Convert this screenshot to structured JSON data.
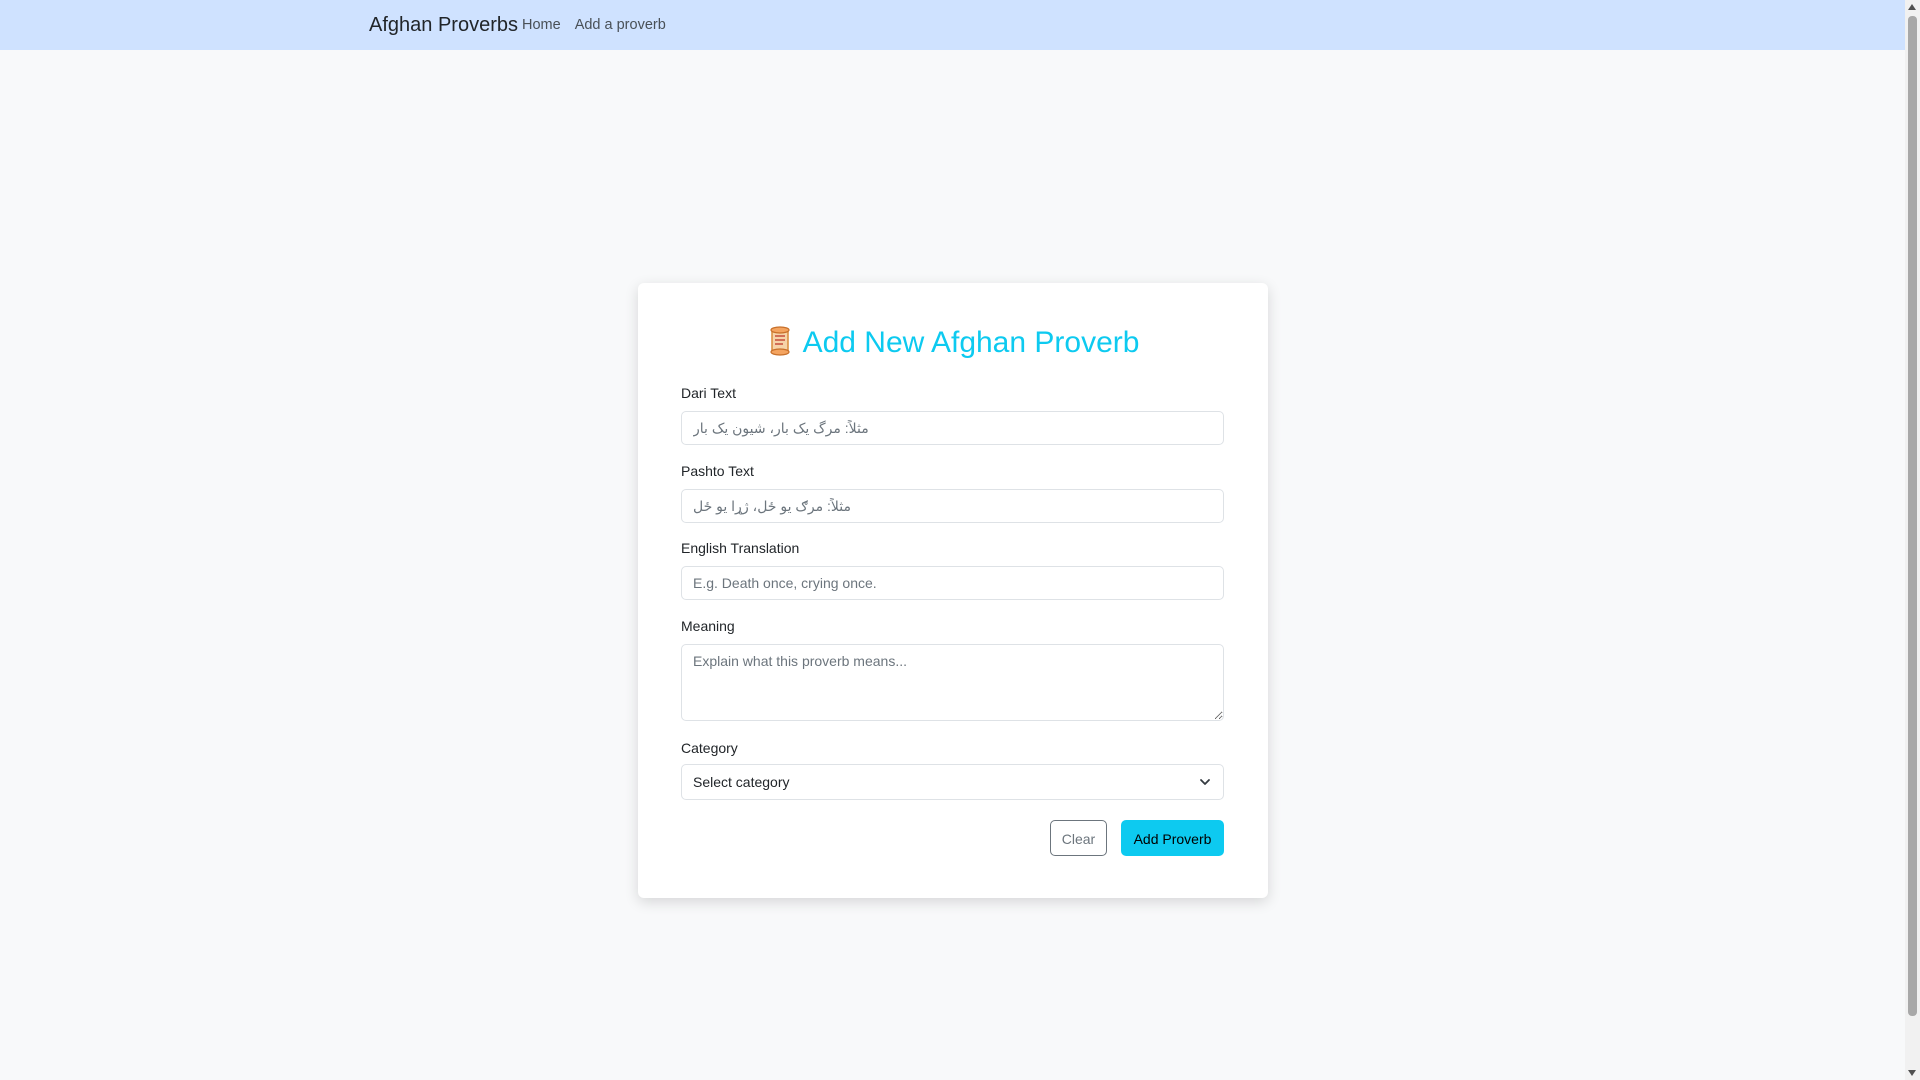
{
  "navbar": {
    "brand": "Afghan Proverbs",
    "links": [
      "Home",
      "Add a proverb"
    ]
  },
  "form": {
    "title": "Add New Afghan Proverb",
    "title_icon": "scroll-icon",
    "accent_color": "#0dcaf0",
    "fields": {
      "dari": {
        "label": "Dari Text",
        "placeholder": "مثلاً: مرگ یک بار، شیون یک بار",
        "value": ""
      },
      "pashto": {
        "label": "Pashto Text",
        "placeholder": "مثلاً: مرګ یو ځل، ژړا یو ځل",
        "value": ""
      },
      "english": {
        "label": "English Translation",
        "placeholder": "E.g. Death once, crying once.",
        "value": ""
      },
      "meaning": {
        "label": "Meaning",
        "placeholder": "Explain what this proverb means...",
        "value": ""
      },
      "category": {
        "label": "Category",
        "selected": "Select category"
      }
    },
    "buttons": {
      "clear": "Clear",
      "submit": "Add Proverb"
    }
  }
}
